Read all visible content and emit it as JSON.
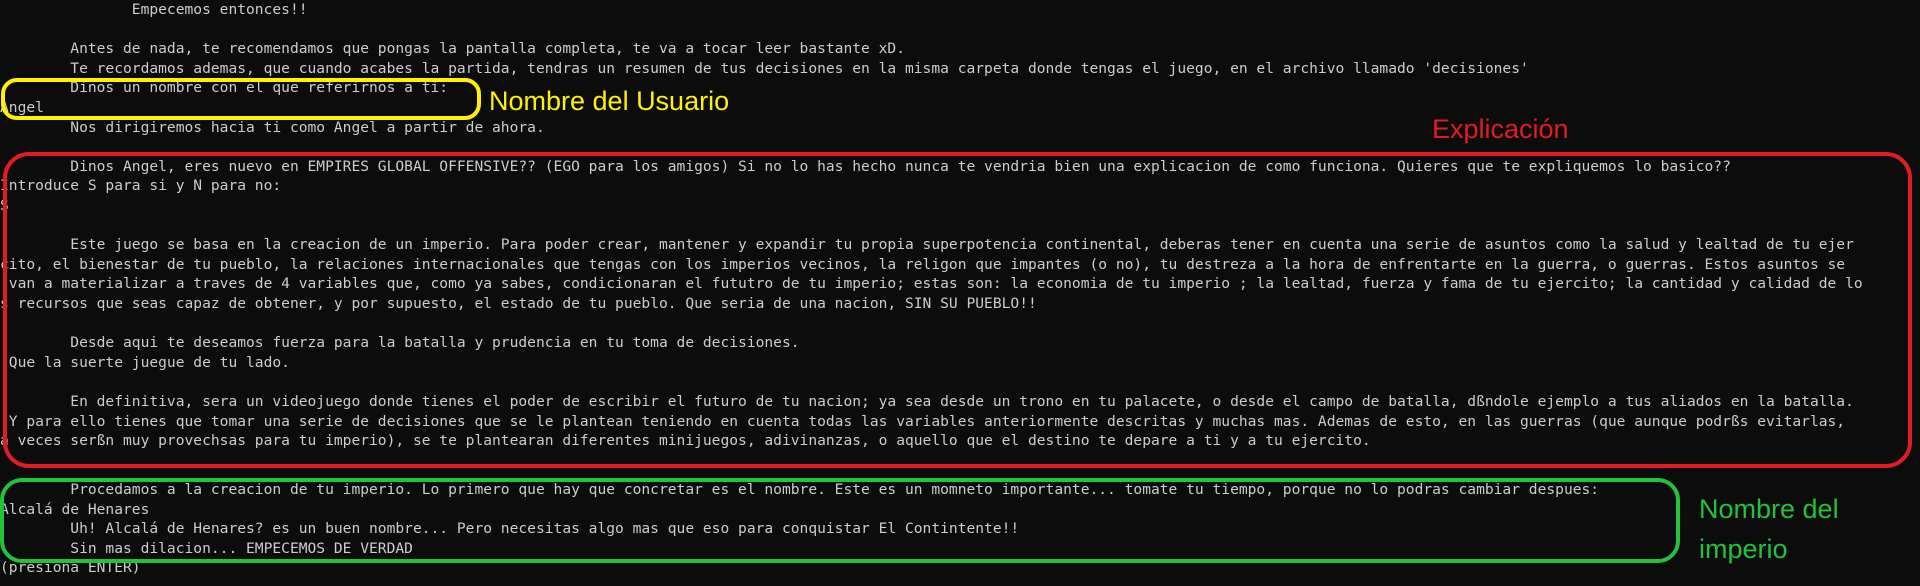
{
  "terminal": {
    "lines": [
      "               Empecemos entonces!!",
      "",
      "        Antes de nada, te recomendamos que pongas la pantalla completa, te va a tocar leer bastante xD.",
      "        Te recordamos ademas, que cuando acabes la partida, tendras un resumen de tus decisiones en la misma carpeta donde tengas el juego, en el archivo llamado 'decisiones'",
      "        Dinos un nombre con el que referirnos a ti:",
      "Angel",
      "        Nos dirigiremos hacia ti como Angel a partir de ahora.",
      "",
      "        Dinos Angel, eres nuevo en EMPIRES GLOBAL OFFENSIVE?? (EGO para los amigos) Si no lo has hecho nunca te vendria bien una explicacion de como funciona. Quieres que te expliquemos lo basico??",
      "Introduce S para si y N para no:",
      "S",
      "",
      "        Este juego se basa en la creacion de un imperio. Para poder crear, mantener y expandir tu propia superpotencia continental, deberas tener en cuenta una serie de asuntos como la salud y lealtad de tu ejer",
      "cito, el bienestar de tu pueblo, la relaciones internacionales que tengas con los imperios vecinos, la religon que impantes (o no), tu destreza a la hora de enfrentarte en la guerra, o guerras. Estos asuntos se",
      " van a materializar a traves de 4 variables que, como ya sabes, condicionaran el fututro de tu imperio; estas son: la economia de tu imperio ; la lealtad, fuerza y fama de tu ejercito; la cantidad y calidad de lo",
      "s recursos que seas capaz de obtener, y por supuesto, el estado de tu pueblo. Que seria de una nacion, SIN SU PUEBLO!!",
      "",
      "        Desde aqui te deseamos fuerza para la batalla y prudencia en tu toma de decisiones.",
      " Que la suerte juegue de tu lado.",
      "",
      "        En definitiva, sera un videojuego donde tienes el poder de escribir el futuro de tu nacion; ya sea desde un trono en tu palacete, o desde el campo de batalla, dßndole ejemplo a tus aliados en la batalla.",
      " Y para ello tienes que tomar una serie de decisiones que se le plantean teniendo en cuenta todas las variables anteriormente descritas y muchas mas. Ademas de esto, en las guerras (que aunque podrßs evitarlas,",
      "a veces serßn muy provechsas para tu imperio), se te plantearan diferentes minijuegos, adivinanzas, o aquello que el destino te depare a ti y a tu ejercito.",
      "",
      "        Procedamos a la creacion de tu imperio. Lo primero que hay que concretar es el nombre. Este es un momneto importante... tomate tu tiempo, porque no lo podras cambiar despues:",
      "Alcalá de Henares",
      "        Uh! Alcalá de Henares? es un buen nombre... Pero necesitas algo mas que eso para conquistar El Contintente!!",
      "        Sin mas dilacion... EMPECEMOS DE VERDAD",
      "(presiona ENTER)"
    ]
  },
  "annotations": {
    "user_name": "Nombre del Usuario",
    "explanation": "Explicación",
    "empire_name": "Nombre del imperio"
  },
  "colors": {
    "background": "#0c0c0c",
    "terminal_text": "#cccccc",
    "yellow": "#fff200",
    "red": "#e21b24",
    "green": "#22c33a"
  }
}
